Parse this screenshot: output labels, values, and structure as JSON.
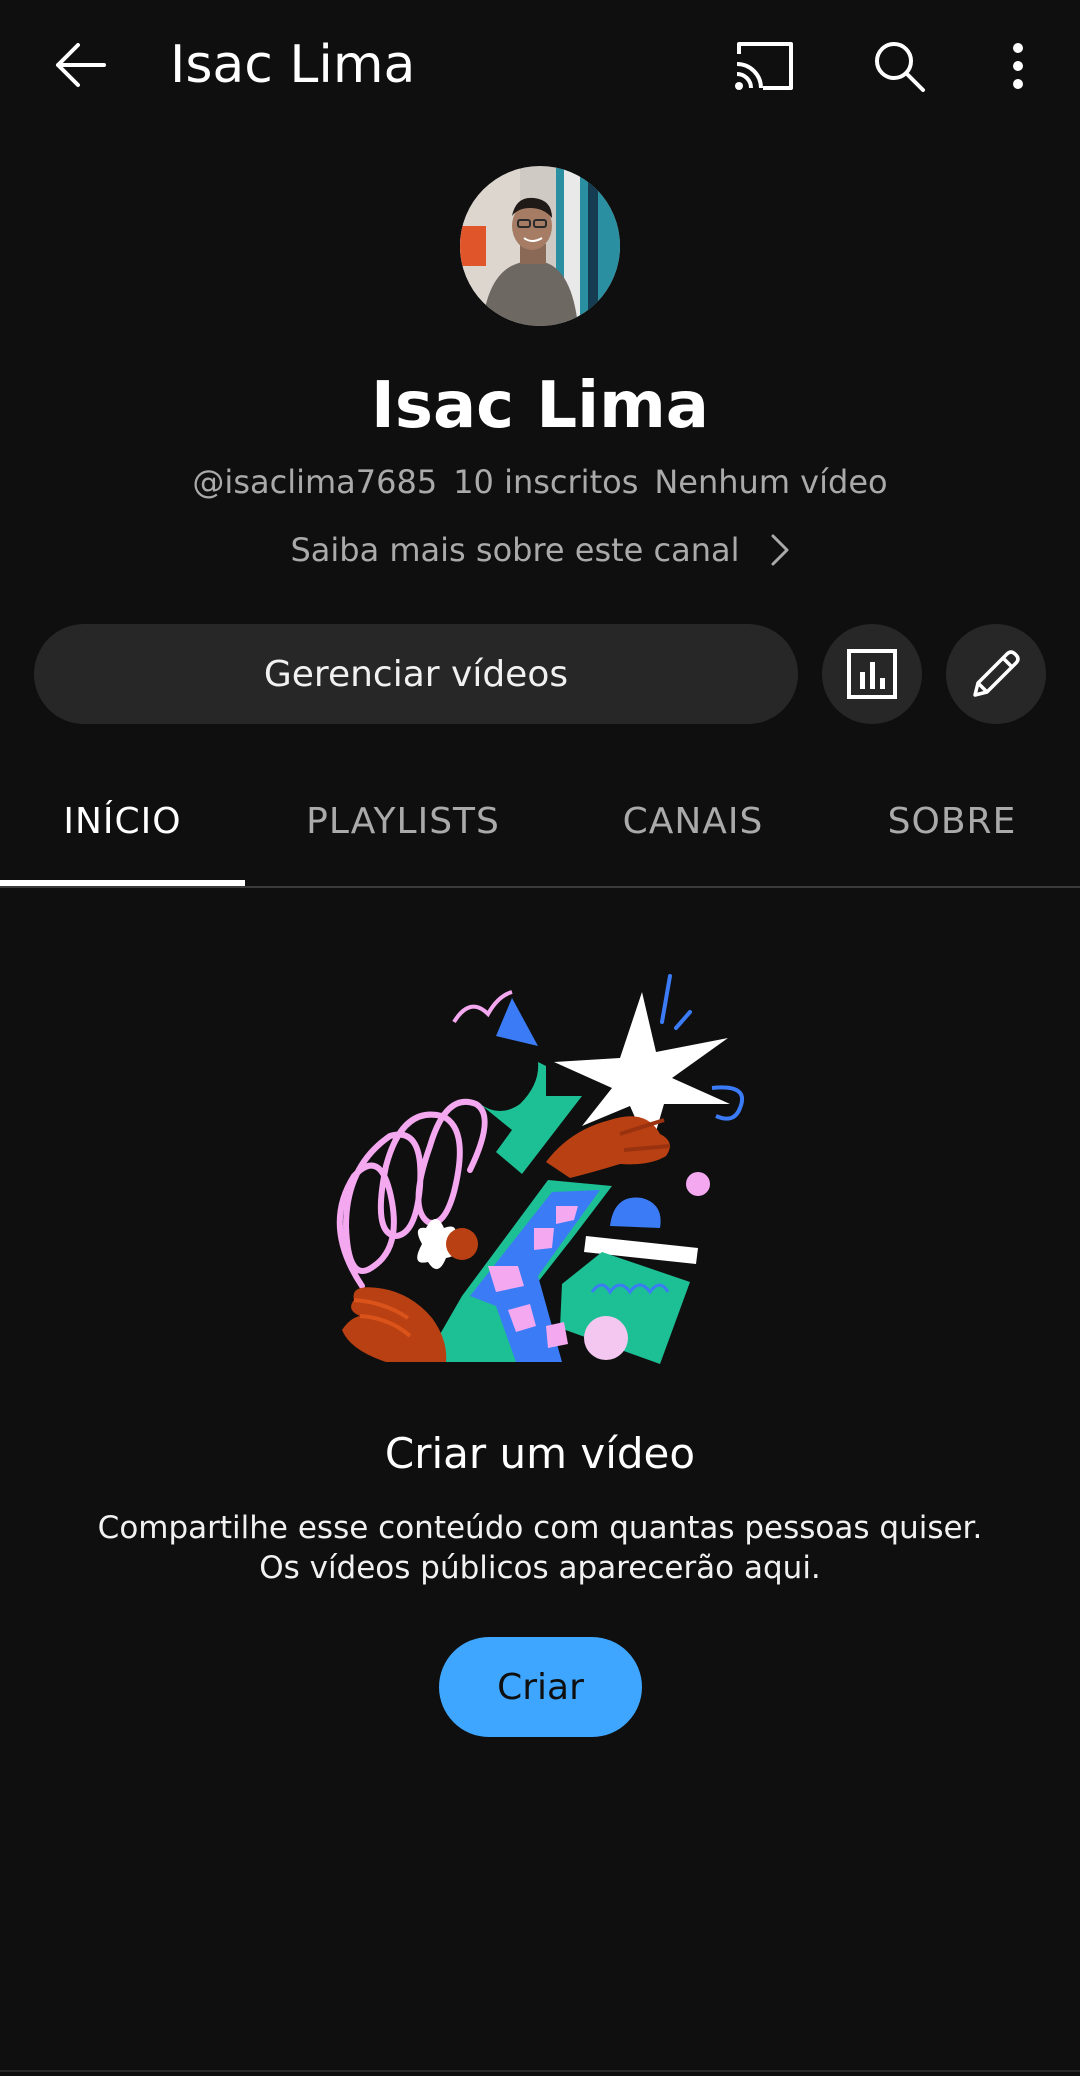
{
  "header": {
    "title": "Isac Lima",
    "back_icon": "arrow-left-icon",
    "cast_icon": "cast-icon",
    "search_icon": "search-icon",
    "more_icon": "more-vertical-icon"
  },
  "channel": {
    "avatar_icon": "channel-avatar",
    "name": "Isac Lima",
    "handle": "@isaclima7685",
    "subscribers": "10 inscritos",
    "videos": "Nenhum vídeo",
    "about_link": "Saiba mais sobre este canal"
  },
  "actions": {
    "manage_videos": "Gerenciar vídeos",
    "analytics_icon": "analytics-icon",
    "edit_icon": "pencil-icon"
  },
  "tabs": [
    {
      "label": "INÍCIO",
      "active": true
    },
    {
      "label": "PLAYLISTS",
      "active": false
    },
    {
      "label": "CANAIS",
      "active": false
    },
    {
      "label": "SOBRE",
      "active": false
    }
  ],
  "empty_state": {
    "title": "Criar um vídeo",
    "description_line1": "Compartilhe esse conteúdo com quantas pessoas quiser.",
    "description_line2": "Os vídeos públicos aparecerão aqui.",
    "button": "Criar"
  },
  "colors": {
    "background": "#0f0f0f",
    "button_bg": "#272727",
    "accent": "#3ea6ff",
    "secondary_text": "#aaaaaa"
  }
}
